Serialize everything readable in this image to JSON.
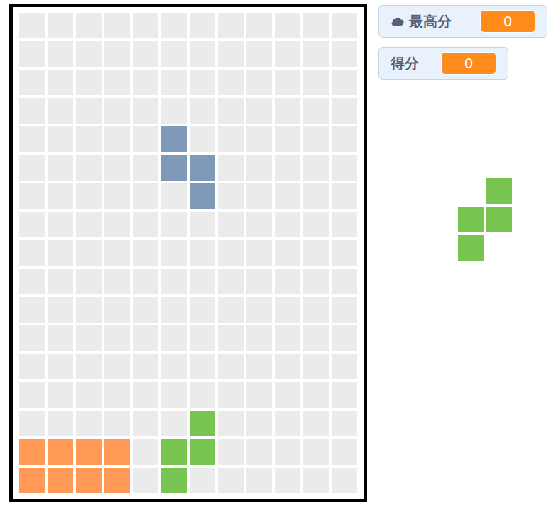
{
  "high_score": {
    "label": "最高分",
    "value": "0"
  },
  "score": {
    "label": "得分",
    "value": "0"
  },
  "board": {
    "rows": 17,
    "cols": 12,
    "blocks": [
      {
        "row": 4,
        "col": 5,
        "color": "#7f9ab8"
      },
      {
        "row": 5,
        "col": 5,
        "color": "#7f9ab8"
      },
      {
        "row": 5,
        "col": 6,
        "color": "#7f9ab8"
      },
      {
        "row": 6,
        "col": 6,
        "color": "#7f9ab8"
      },
      {
        "row": 14,
        "col": 6,
        "color": "#77c451"
      },
      {
        "row": 15,
        "col": 5,
        "color": "#77c451"
      },
      {
        "row": 15,
        "col": 6,
        "color": "#77c451"
      },
      {
        "row": 16,
        "col": 5,
        "color": "#77c451"
      },
      {
        "row": 15,
        "col": 0,
        "color": "#ff9955"
      },
      {
        "row": 15,
        "col": 1,
        "color": "#ff9955"
      },
      {
        "row": 15,
        "col": 2,
        "color": "#ff9955"
      },
      {
        "row": 15,
        "col": 3,
        "color": "#ff9955"
      },
      {
        "row": 16,
        "col": 0,
        "color": "#ff9955"
      },
      {
        "row": 16,
        "col": 1,
        "color": "#ff9955"
      },
      {
        "row": 16,
        "col": 2,
        "color": "#ff9955"
      },
      {
        "row": 16,
        "col": 3,
        "color": "#ff9955"
      }
    ]
  },
  "next_piece": {
    "color": "#77c451",
    "blocks": [
      {
        "row": 0,
        "col": 1
      },
      {
        "row": 1,
        "col": 0
      },
      {
        "row": 1,
        "col": 1
      },
      {
        "row": 2,
        "col": 0
      }
    ]
  }
}
